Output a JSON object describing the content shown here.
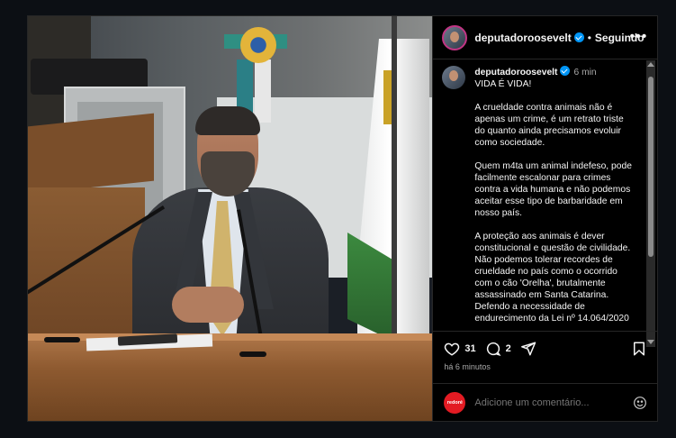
{
  "post": {
    "username": "deputadoroosevelt",
    "follow_status": "Seguindo",
    "separator": "•",
    "more_label": "•••",
    "caption_time": "6 min",
    "caption_paragraphs": [
      "VIDA É VIDA!",
      "A crueldade contra animais não é apenas um crime, é um retrato triste do quanto ainda precisamos evoluir como sociedade.",
      "Quem m4ta um animal indefeso, pode facilmente escalonar para crimes contra a vida humana e não podemos aceitar esse tipo de barbaridade em nosso país.",
      "A proteção aos animais é dever constitucional e questão de civilidade. Não podemos tolerar recordes de crueldade no país como o ocorrido com o cão 'Orelha', brutalmente assassinado em Santa Catarina. Defendo a necessidade de endurecimento da Lei nº 14.064/2020"
    ],
    "likes": "31",
    "comments": "2",
    "posted_ago": "há 6 minutos"
  },
  "comment_box": {
    "avatar_label": "redoré",
    "placeholder": "Adicione um comentário..."
  },
  "icons": {
    "verified": "verified-badge-icon",
    "like": "heart-icon",
    "comment": "comment-icon",
    "share": "share-icon",
    "save": "bookmark-icon",
    "emoji": "emoji-icon"
  },
  "colors": {
    "background": "#000000",
    "verified": "#0095f6",
    "muted_text": "#a8a8a8",
    "avatar_comment": "#e31b23"
  }
}
